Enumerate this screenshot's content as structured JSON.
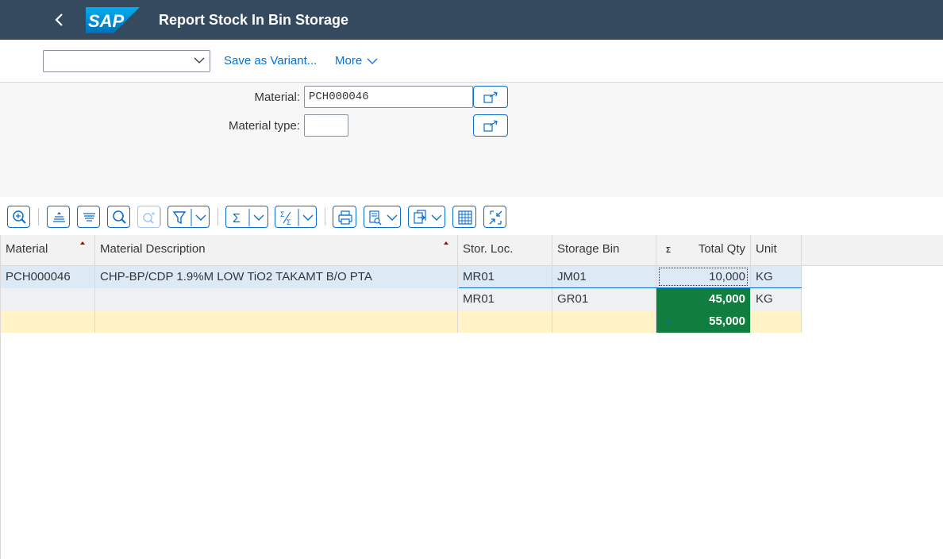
{
  "shell": {
    "back_label": "‹",
    "logo_text": "SAP",
    "title": "Report Stock In Bin Storage",
    "brand_color": "#0a6ed1",
    "shell_color": "#354a5f"
  },
  "toolbar": {
    "variant_value": "",
    "save_variant_label": "Save as Variant...",
    "more_label": "More"
  },
  "filter": {
    "material_label": "Material:",
    "material_value": "PCH000046",
    "material_type_label": "Material type:",
    "material_type_value": ""
  },
  "alv_toolbar": {
    "icons": [
      "zoom-details-icon",
      "sort-ascending-icon",
      "sort-descending-icon",
      "find-icon",
      "find-next-icon",
      "filter-icon",
      "total-icon",
      "subtotal-icon",
      "print-icon",
      "views-icon",
      "export-icon",
      "layout-grid-icon",
      "exit-fullscreen-icon"
    ]
  },
  "grid": {
    "columns": [
      "Material",
      "Material Description",
      "Stor. Loc.",
      "Storage Bin",
      "Total Qty",
      "Unit"
    ],
    "total_marker": "Σ",
    "rows": [
      {
        "material": "PCH000046",
        "description": "CHP-BP/CDP 1.9%M LOW TiO2 TAKAMT B/O PTA",
        "stor_loc": "MR01",
        "bin": "JM01",
        "qty": "10,000",
        "unit": "KG"
      },
      {
        "material": "",
        "description": "",
        "stor_loc": "MR01",
        "bin": "GR01",
        "qty": "45,000",
        "unit": "KG"
      }
    ],
    "total": {
      "qty": "55,000"
    },
    "total_color": "#107e3e",
    "total_row_color": "#fff3c7"
  }
}
